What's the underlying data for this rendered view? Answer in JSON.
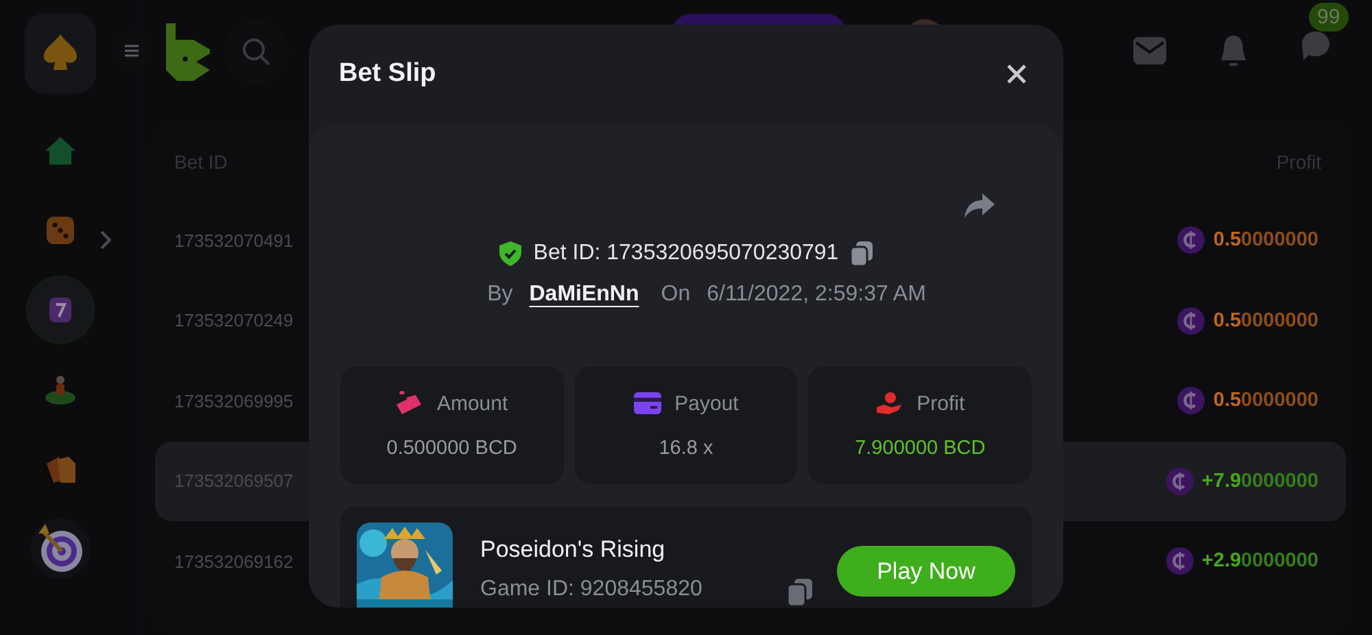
{
  "header": {
    "badge": "99"
  },
  "sidebar": {
    "items": [
      {
        "kind": "home",
        "selected": false
      },
      {
        "kind": "dice",
        "selected": false
      },
      {
        "kind": "slot",
        "selected": true
      },
      {
        "kind": "figure",
        "selected": false
      },
      {
        "kind": "tags",
        "selected": false
      },
      {
        "kind": "target",
        "selected": false
      }
    ]
  },
  "table": {
    "columns": [
      "Bet ID",
      "Profit"
    ],
    "rows": [
      {
        "bet_id": "173532070491",
        "color": "#c0661a",
        "profit_lead": "0.5",
        "profit_tail": "0000000",
        "selected": false
      },
      {
        "bet_id": "173532070249",
        "color": "#c0661a",
        "profit_lead": "0.5",
        "profit_tail": "0000000",
        "selected": false
      },
      {
        "bet_id": "173532069995",
        "color": "#c0661a",
        "profit_lead": "0.5",
        "profit_tail": "0000000",
        "selected": false
      },
      {
        "bet_id": "173532069507",
        "color": "#46a81e",
        "profit_lead": "+7.9",
        "profit_tail": "0000000",
        "selected": true
      },
      {
        "bet_id": "173532069162",
        "color": "#46a81e",
        "profit_lead": "+2.9",
        "profit_tail": "0000000",
        "selected": false
      }
    ]
  },
  "dialog": {
    "title": "Bet Slip",
    "bet_id": "Bet ID: 1735320695070230791",
    "by_label": "By",
    "user": "DaMiEnNn",
    "on_label": "On",
    "date": "6/11/2022, 2:59:37 AM",
    "stats": [
      {
        "kind": "amount",
        "label": "Amount",
        "value": "0.500000 BCD",
        "color": "#9a9ca3"
      },
      {
        "kind": "payout",
        "label": "Payout",
        "value": "16.8 x",
        "color": "#9a9ca3"
      },
      {
        "kind": "profit",
        "label": "Profit",
        "value": "7.900000 BCD",
        "color": "#5fc32c"
      }
    ],
    "game": {
      "kind": "picture",
      "title": "Poseidon's Rising",
      "game_id": "Game ID: 9208455820",
      "button": "Play Now"
    }
  }
}
